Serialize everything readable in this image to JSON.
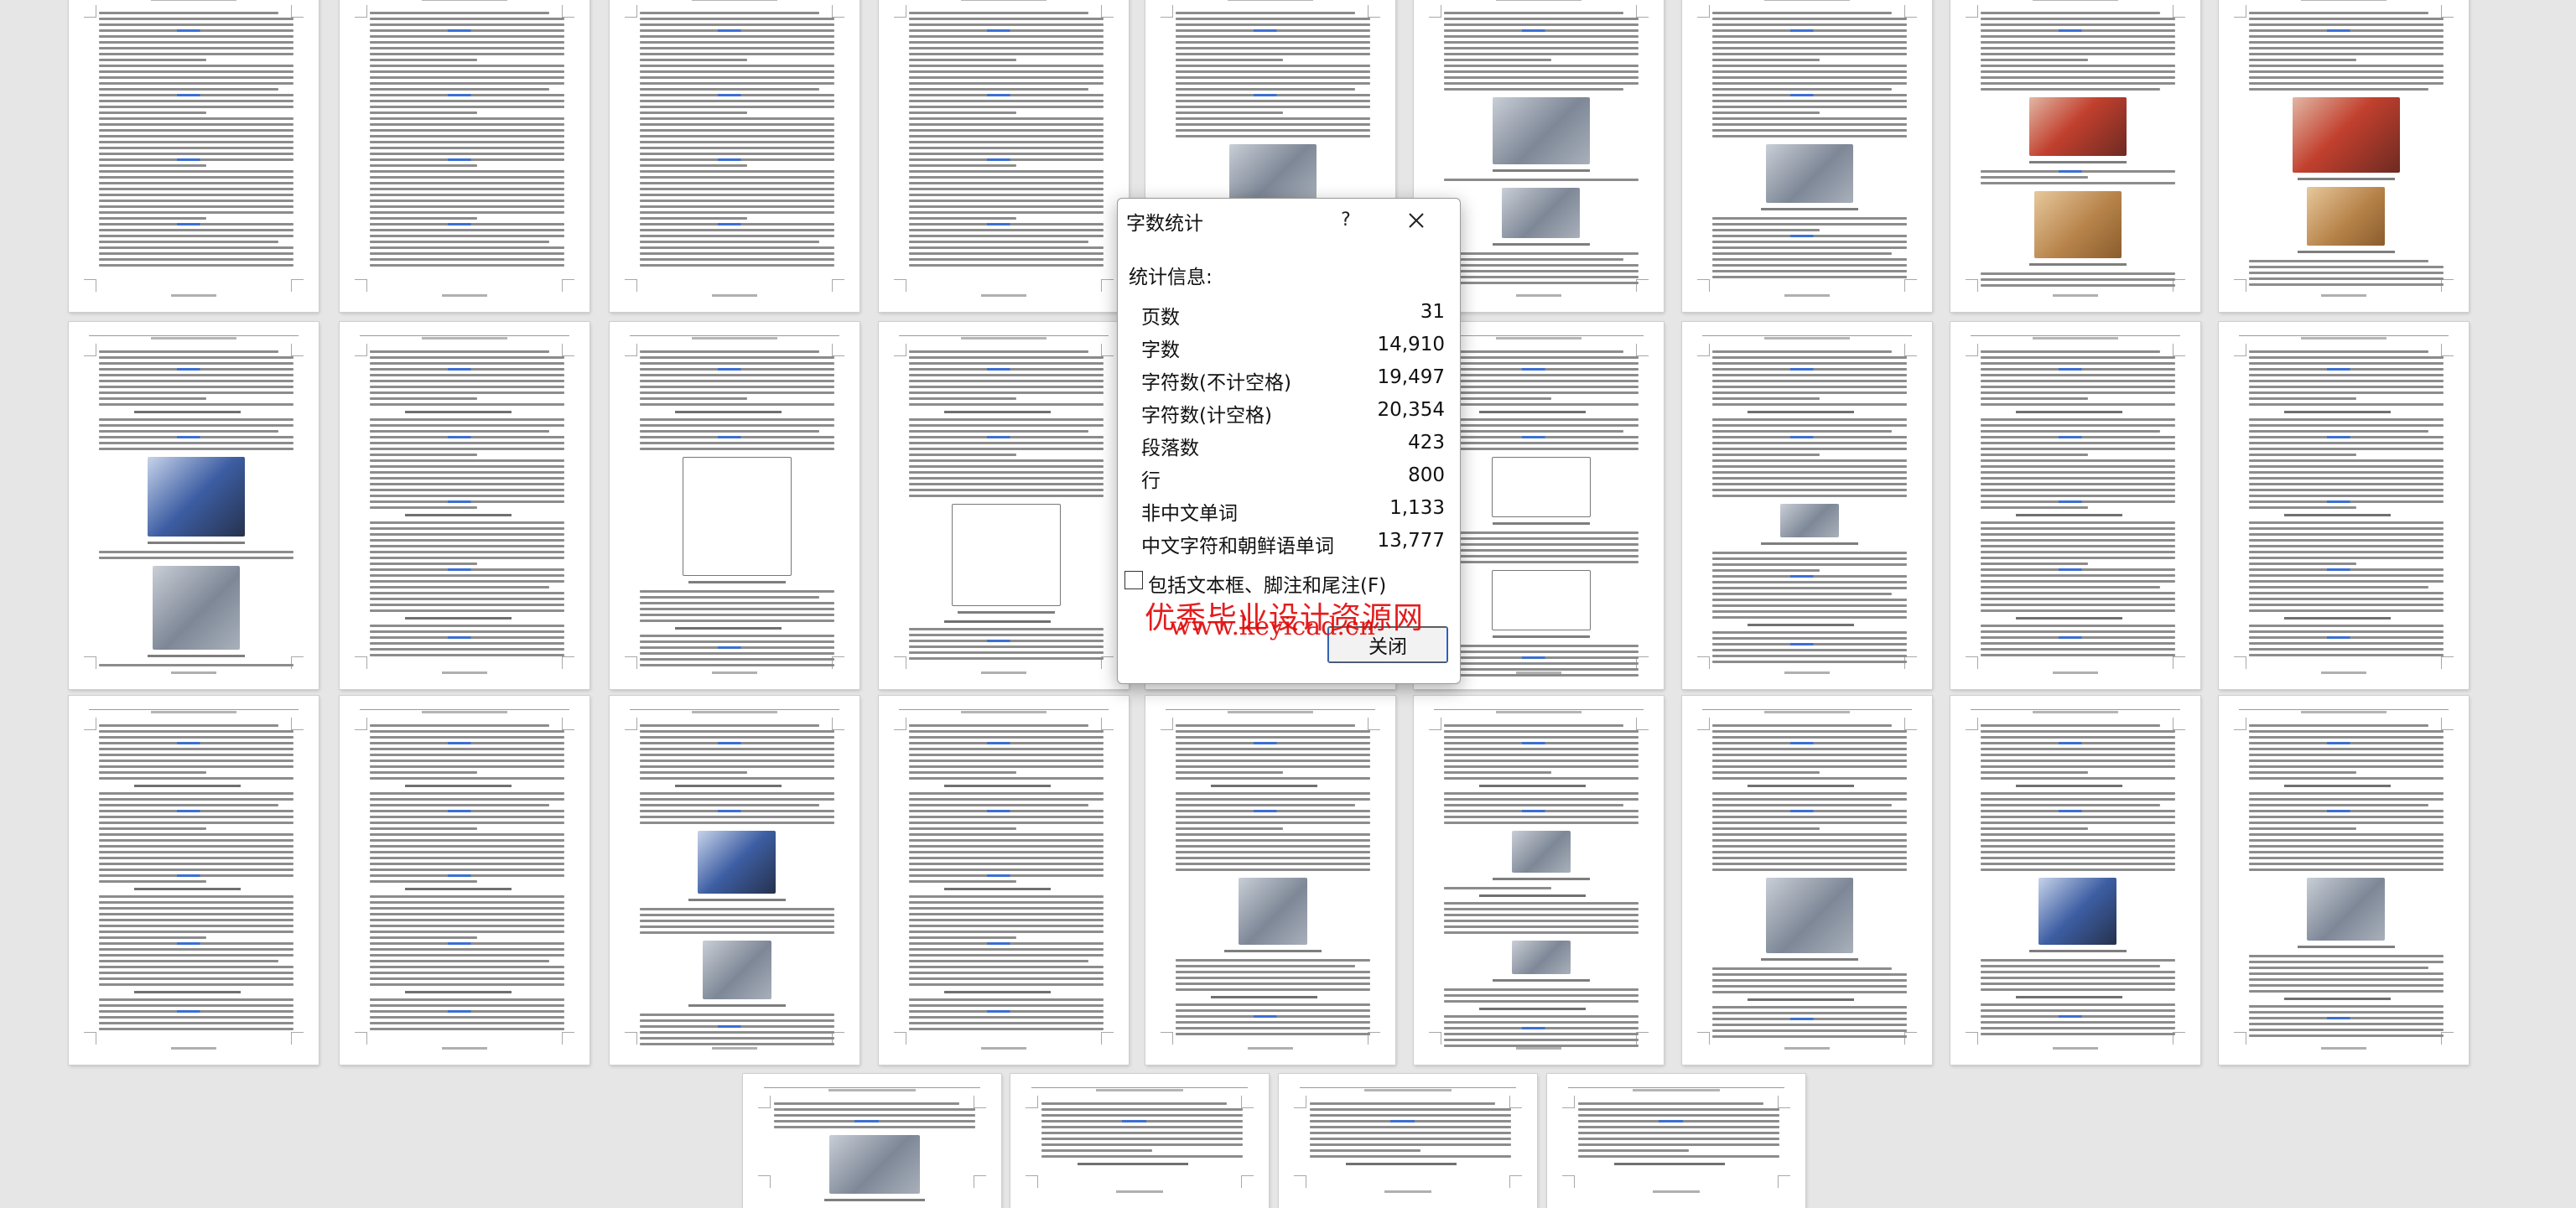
{
  "dialog": {
    "title": "字数统计",
    "help_label": "?",
    "section_label": "统计信息:",
    "stats": [
      {
        "label": "页数",
        "value": "31"
      },
      {
        "label": "字数",
        "value": "14,910"
      },
      {
        "label": "字符数(不计空格)",
        "value": "19,497"
      },
      {
        "label": "字符数(计空格)",
        "value": "20,354"
      },
      {
        "label": "段落数",
        "value": "423"
      },
      {
        "label": "行",
        "value": "800"
      },
      {
        "label": "非中文单词",
        "value": "1,133"
      },
      {
        "label": "中文字符和朝鲜语单词",
        "value": "13,777"
      }
    ],
    "include_checkbox": {
      "label": "包括文本框、脚注和尾注(F)",
      "checked": false
    },
    "close_button": "关闭",
    "close_icon": "close-icon"
  },
  "watermark": {
    "line1": "优秀毕业设计资源网",
    "line2": "www.keyicad.cn",
    "color": "#e10c0c"
  },
  "document": {
    "page_count_visible": 31,
    "pages_per_row": [
      9,
      9,
      9,
      4
    ]
  }
}
